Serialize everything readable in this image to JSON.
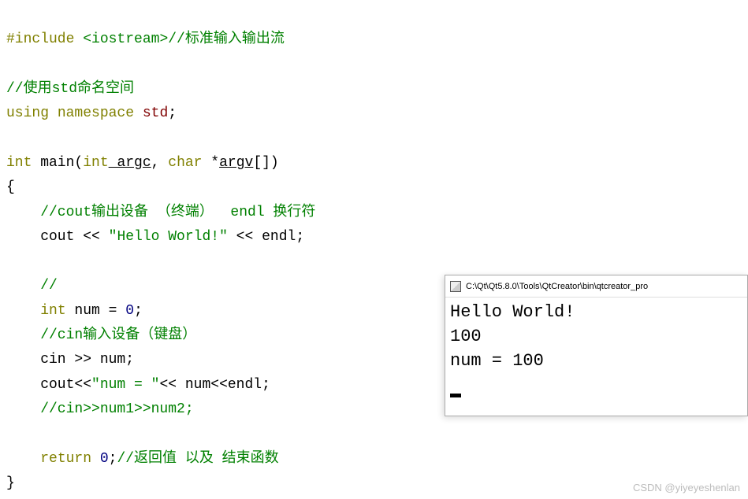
{
  "code": {
    "l1_include": "#include",
    "l1_header": " <iostream>",
    "l1_comment": "//标准输入输出流",
    "l3_comment": "//使用std命名空间",
    "l4_using": "using",
    "l4_namespace": " namespace",
    "l4_std": " std",
    "l4_semi": ";",
    "l6_int": "int",
    "l6_main": " main",
    "l6_paren1": "(",
    "l6_int2": "int",
    "l6_argc": " argc",
    "l6_comma": ",",
    "l6_char": " char",
    "l6_star": " *",
    "l6_argv": "argv",
    "l6_brackets": "[])",
    "l7_brace": "{",
    "l8_comment": "    //cout输出设备 （终端）  endl 换行符",
    "l9_indent": "    cout",
    "l9_op1": " << ",
    "l9_str": "\"Hello World!\"",
    "l9_op2": " << ",
    "l9_endl": "endl",
    "l9_semi": ";",
    "l11_comment": "    //",
    "l12_indent": "    ",
    "l12_int": "int",
    "l12_rest": " num = ",
    "l12_zero": "0",
    "l12_semi": ";",
    "l13_comment": "    //cin输入设备（键盘）",
    "l14_text": "    cin >> num;",
    "l15_text1": "    cout<<",
    "l15_str": "\"num = \"",
    "l15_text2": "<< num<<endl;",
    "l16_comment": "    //cin>>num1>>num2;",
    "l18_indent": "    ",
    "l18_return": "return",
    "l18_zero": " 0",
    "l18_semi": ";",
    "l18_comment": "//返回值 以及 结束函数",
    "l19_brace": "}"
  },
  "console": {
    "title": "C:\\Qt\\Qt5.8.0\\Tools\\QtCreator\\bin\\qtcreator_pro",
    "line1": "Hello World!",
    "line2": "100",
    "line3": "num = 100"
  },
  "watermark": "CSDN @yiyeyeshenlan"
}
